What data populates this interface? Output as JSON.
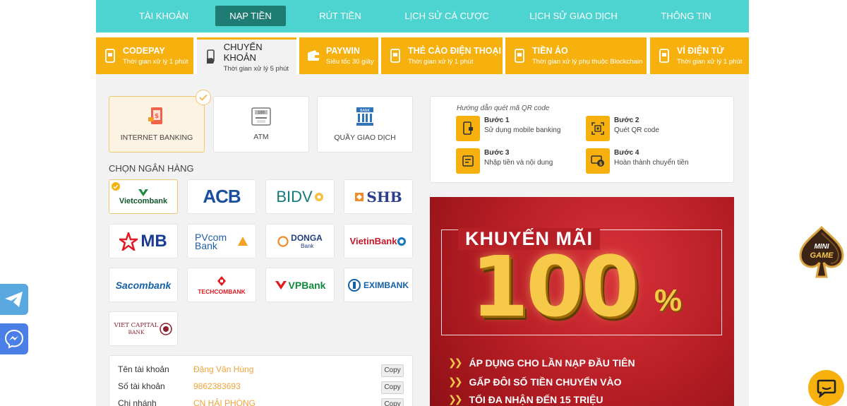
{
  "nav": {
    "items": [
      {
        "label": "TÀI KHOẢN"
      },
      {
        "label": "NẠP TIỀN"
      },
      {
        "label": "RÚT TIỀN"
      },
      {
        "label": "LỊCH SỬ CÁ CƯỢC"
      },
      {
        "label": "LỊCH SỬ GIAO DỊCH"
      },
      {
        "label": "THÔNG TIN"
      }
    ],
    "active": "NẠP TIỀN"
  },
  "tabs": [
    {
      "title": "CODEPAY",
      "sub": "Thời gian xử lý 1 phút"
    },
    {
      "title": "CHUYỂN KHOẢN",
      "sub": "Thời gian xử lý 5 phút"
    },
    {
      "title": "PAYWIN",
      "sub": "Siêu tốc 30 giây"
    },
    {
      "title": "THẺ CÀO ĐIỆN THOẠI",
      "sub": "Thời gian xử lý 1 phút"
    },
    {
      "title": "TIỀN ẢO",
      "sub": "Thời gian xử lý phụ thuộc Blockchain"
    },
    {
      "title": "VÍ ĐIỆN TỬ",
      "sub": "Thời gian xử lý 1 phút"
    }
  ],
  "transfer_types": [
    {
      "label": "INTERNET BANKING"
    },
    {
      "label": "ATM"
    },
    {
      "label": "QUẦY GIAO DỊCH"
    }
  ],
  "bank_section_title": "CHỌN NGÂN HÀNG",
  "banks": [
    {
      "name": "Vietcombank"
    },
    {
      "name": "ACB"
    },
    {
      "name": "BIDV"
    },
    {
      "name": "SHB"
    },
    {
      "name": "MB"
    },
    {
      "name": "PVcom Bank"
    },
    {
      "name": "DONGA",
      "sub": "Bank"
    },
    {
      "name": "VietinBank"
    },
    {
      "name": "Sacombank"
    },
    {
      "name": "TECHCOMBANK"
    },
    {
      "name": "VPBank"
    },
    {
      "name": "EXIMBANK"
    },
    {
      "name": "VIET CAPITAL",
      "sub": "BANK"
    }
  ],
  "account": {
    "rows": [
      {
        "label": "Tên tài khoản",
        "value": "Đặng Văn Hùng"
      },
      {
        "label": "Số tài khoản",
        "value": "9862383693"
      },
      {
        "label": "Chi nhánh",
        "value": "CN HẢI PHÒNG"
      }
    ],
    "copy_label": "Copy"
  },
  "guide": {
    "heading": "Hướng dẫn quét mã QR code",
    "steps": [
      {
        "title": "Bước 1",
        "desc": "Sử dụng mobile banking"
      },
      {
        "title": "Bước 2",
        "desc": "Quét QR code"
      },
      {
        "title": "Bước 3",
        "desc": "Nhập tiền và nội dung"
      },
      {
        "title": "Bước 4",
        "desc": "Hoàn thành chuyển tiền"
      }
    ]
  },
  "promo": {
    "title": "KHUYẾN MÃI",
    "big": "100",
    "pct": "%",
    "bullets": [
      "ÁP DỤNG CHO LẦN NẠP ĐẦU TIÊN",
      "GẤP ĐÔI SỐ TIỀN CHUYỂN VÀO",
      "TỐI ĐA NHẬN ĐẾN 15 TRIỆU"
    ]
  },
  "minigame": {
    "line1": "MINI",
    "line2": "GAME"
  },
  "colors": {
    "teal": "#4dd4d0",
    "nav_active": "#1f7c74",
    "accent": "#f6b10f",
    "promo_red": "#b51d24"
  }
}
